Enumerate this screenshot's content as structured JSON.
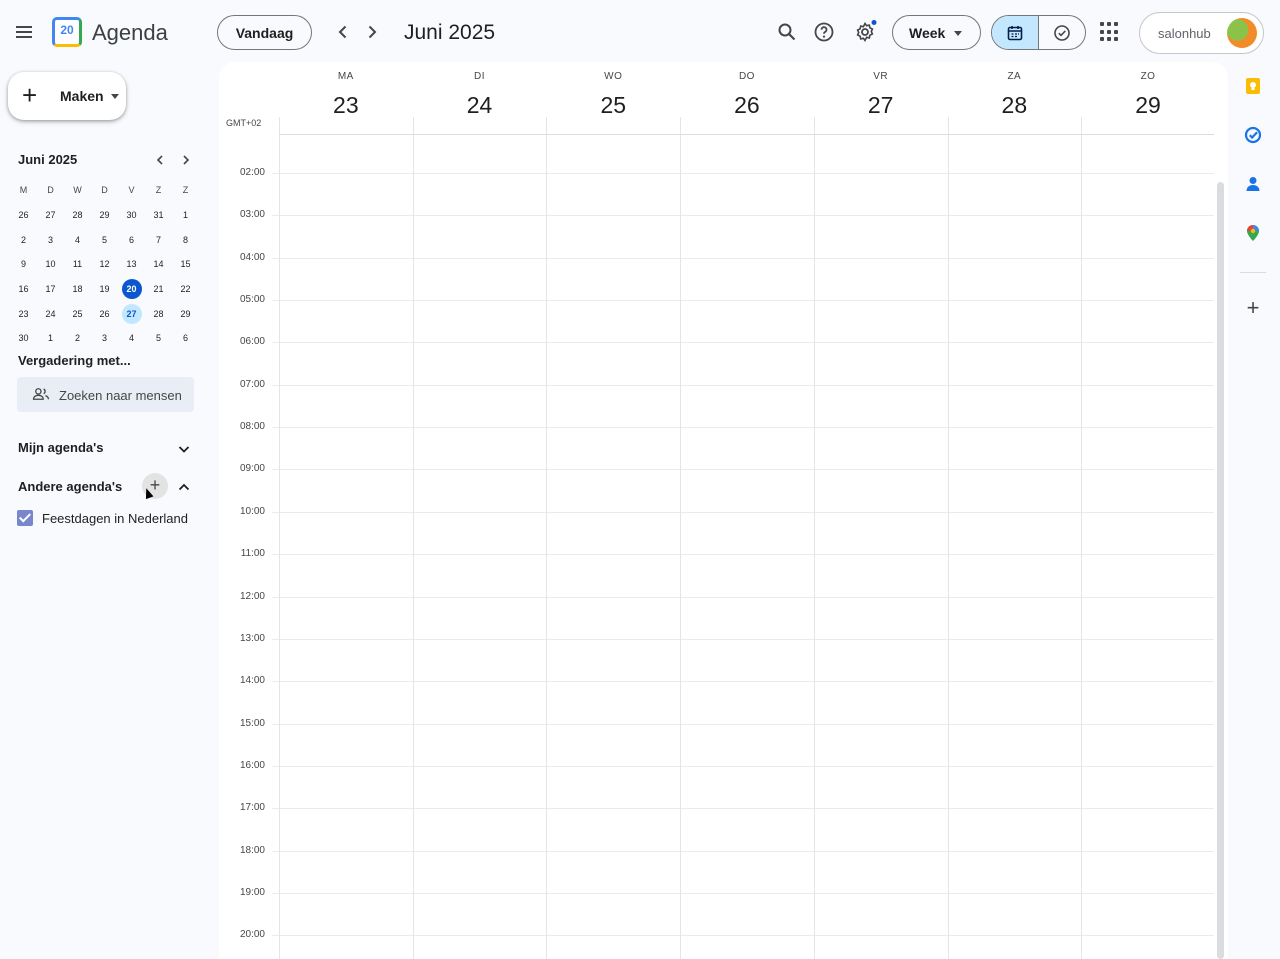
{
  "header": {
    "app_title": "Agenda",
    "logo_day": "20",
    "today_label": "Vandaag",
    "month_title": "Juni 2025",
    "view_label": "Week",
    "account_brand": "salonhub",
    "icons": [
      "menu-icon",
      "chevron-left-icon",
      "chevron-right-icon",
      "search-icon",
      "help-icon",
      "gear-icon",
      "calendar-icon",
      "tasks-check-icon",
      "apps-grid-icon"
    ],
    "colors": {
      "accent": "#0b57d0",
      "selected_toggle": "#c2e7ff",
      "notification_dot": "#0b57d0"
    }
  },
  "sidebar": {
    "create_label": "Maken",
    "mini_calendar": {
      "title": "Juni 2025",
      "weekday_heads": [
        "M",
        "D",
        "W",
        "D",
        "V",
        "Z",
        "Z"
      ],
      "weeks": [
        [
          "26",
          "27",
          "28",
          "29",
          "30",
          "31",
          "1"
        ],
        [
          "2",
          "3",
          "4",
          "5",
          "6",
          "7",
          "8"
        ],
        [
          "9",
          "10",
          "11",
          "12",
          "13",
          "14",
          "15"
        ],
        [
          "16",
          "17",
          "18",
          "19",
          "20",
          "21",
          "22"
        ],
        [
          "23",
          "24",
          "25",
          "26",
          "27",
          "28",
          "29"
        ],
        [
          "30",
          "1",
          "2",
          "3",
          "4",
          "5",
          "6"
        ]
      ],
      "today": "20",
      "selected": "27"
    },
    "meeting_title": "Vergadering met...",
    "search_people_label": "Zoeken naar mensen",
    "my_calendars_label": "Mijn agenda's",
    "other_calendars_label": "Andere agenda's",
    "other_calendars": [
      {
        "label": "Feestdagen in Nederland",
        "checked": true,
        "color": "#7986cb"
      }
    ]
  },
  "week": {
    "timezone": "GMT+02",
    "days": [
      {
        "dow": "MA",
        "num": "23"
      },
      {
        "dow": "DI",
        "num": "24"
      },
      {
        "dow": "WO",
        "num": "25"
      },
      {
        "dow": "DO",
        "num": "26"
      },
      {
        "dow": "VR",
        "num": "27"
      },
      {
        "dow": "ZA",
        "num": "28"
      },
      {
        "dow": "ZO",
        "num": "29"
      }
    ],
    "hours": [
      "02:00",
      "03:00",
      "04:00",
      "05:00",
      "06:00",
      "07:00",
      "08:00",
      "09:00",
      "10:00",
      "11:00",
      "12:00",
      "13:00",
      "14:00",
      "15:00",
      "16:00",
      "17:00",
      "18:00",
      "19:00",
      "20:00"
    ]
  },
  "side_panel": {
    "icons": [
      "keep-icon",
      "tasks-icon",
      "contacts-icon",
      "maps-icon",
      "add-icon"
    ]
  }
}
